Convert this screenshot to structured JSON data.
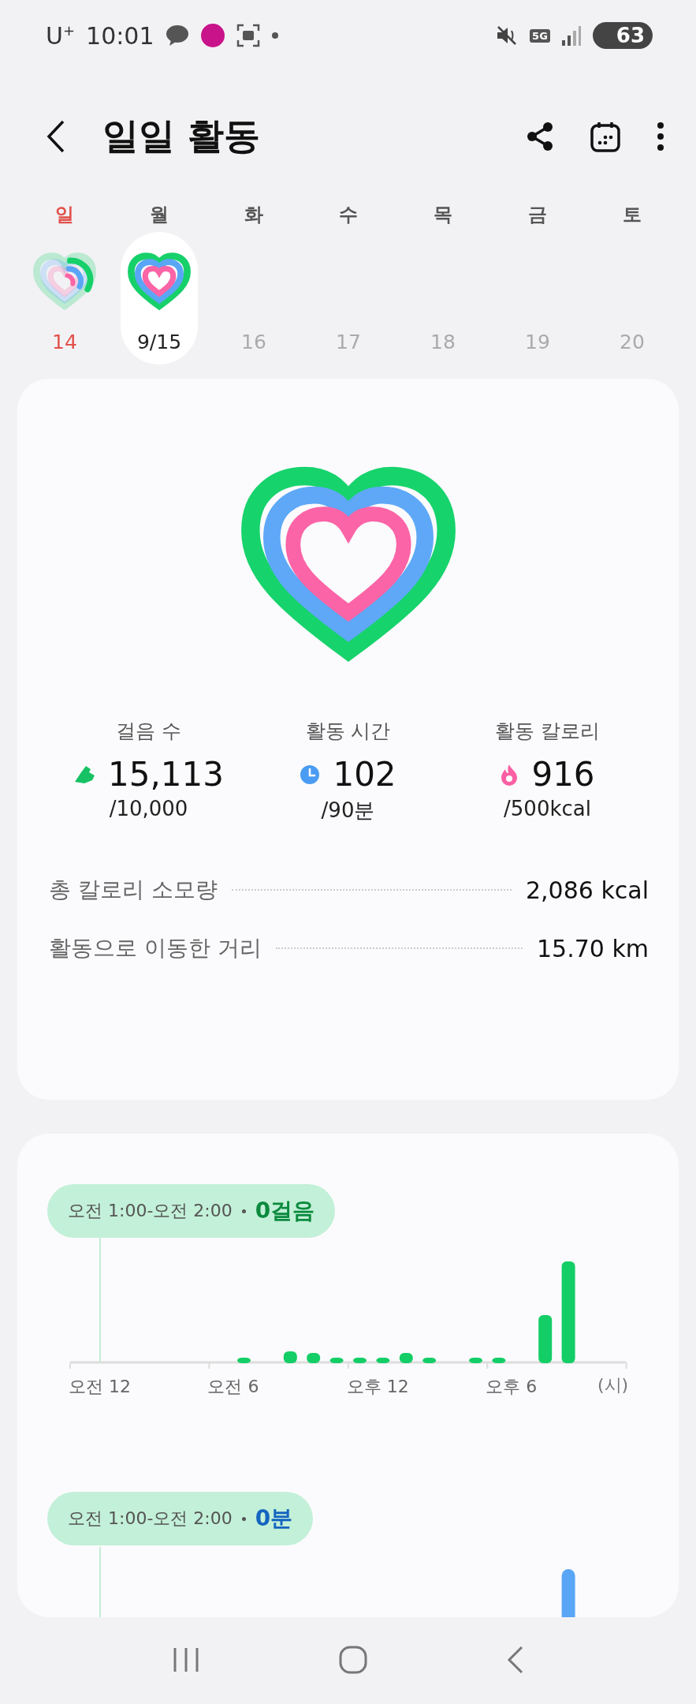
{
  "status_bar": {
    "carrier": "U$^{+}$",
    "time": "10:01",
    "network": "5G",
    "battery": "63"
  },
  "header": {
    "title": "일일 활동"
  },
  "week": [
    {
      "day": "일",
      "date": "14",
      "color": "#e2504a",
      "kind": "partial",
      "selected": false,
      "disabled": false
    },
    {
      "day": "월",
      "date": "9/15",
      "color": "#555555",
      "kind": "full",
      "selected": true,
      "disabled": false
    },
    {
      "day": "화",
      "date": "16",
      "color": "#555555",
      "kind": "empty",
      "selected": false,
      "disabled": true
    },
    {
      "day": "수",
      "date": "17",
      "color": "#555555",
      "kind": "empty",
      "selected": false,
      "disabled": true
    },
    {
      "day": "목",
      "date": "18",
      "color": "#555555",
      "kind": "empty",
      "selected": false,
      "disabled": true
    },
    {
      "day": "금",
      "date": "19",
      "color": "#555555",
      "kind": "empty",
      "selected": false,
      "disabled": true
    },
    {
      "day": "토",
      "date": "20",
      "color": "#555555",
      "kind": "empty",
      "selected": false,
      "disabled": true
    }
  ],
  "summary": {
    "stats": [
      {
        "kind": "steps",
        "label": "걸음 수",
        "value": "15,113",
        "goal": "/10,000"
      },
      {
        "kind": "time",
        "label": "활동 시간",
        "value": "102",
        "goal": "/90분"
      },
      {
        "kind": "calories",
        "label": "활동 칼로리",
        "value": "916",
        "goal": "/500kcal"
      }
    ],
    "rows": [
      {
        "label": "총 칼로리 소모량",
        "value": "2,086 kcal"
      },
      {
        "label": "활동으로 이동한 거리",
        "value": "15.70 km"
      }
    ]
  },
  "charts": [
    {
      "kind": "steps",
      "tooltip": {
        "range": "오전 1:00-오전 2:00",
        "value": "0걸음"
      },
      "x_labels": [
        "오전 12",
        "오전 6",
        "오후 12",
        "오후 6"
      ],
      "unit": "(시)"
    },
    {
      "kind": "time",
      "tooltip": {
        "range": "오전 1:00-오전 2:00",
        "value": "0분"
      }
    }
  ]
}
